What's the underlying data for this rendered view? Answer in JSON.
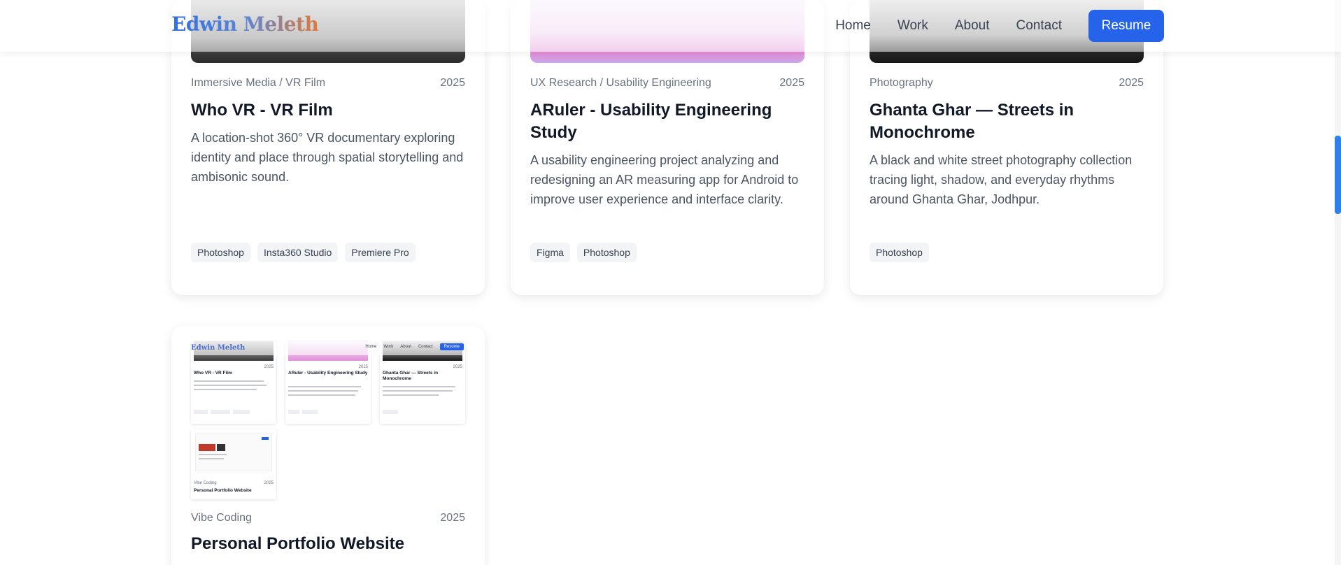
{
  "header": {
    "brand": "Edwin Meleth",
    "nav": [
      "Home",
      "Work",
      "About",
      "Contact"
    ],
    "resume_label": "Resume"
  },
  "projects": [
    {
      "category": "Immersive Media / VR Film",
      "year": "2025",
      "title": "Who VR - VR Film",
      "description": "A location-shot 360° VR documentary exploring identity and place through spatial storytelling and ambisonic sound.",
      "tags": [
        "Photoshop",
        "Insta360 Studio",
        "Premiere Pro"
      ]
    },
    {
      "category": "UX Research / Usability Engineering",
      "year": "2025",
      "title": "ARuler - Usability Engineering Study",
      "description": "A usability engineering project analyzing and redesigning an AR measuring app for Android to improve user experience and interface clarity.",
      "tags": [
        "Figma",
        "Photoshop"
      ]
    },
    {
      "category": "Photography",
      "year": "2025",
      "title": "Ghanta Ghar — Streets in Monochrome",
      "description": "A black and white street photography collection tracing light, shadow, and everyday rhythms around Ghanta Ghar, Jodhpur.",
      "tags": [
        "Photoshop"
      ]
    },
    {
      "category": "Vibe Coding",
      "year": "2025",
      "title": "Personal Portfolio Website"
    }
  ],
  "mini_preview": {
    "brand": "Edwin Meleth",
    "nav": [
      "Home",
      "Work",
      "About",
      "Contact"
    ],
    "resume_label": "Resume",
    "cards": [
      {
        "title": "Who VR - VR Film",
        "year": "2025"
      },
      {
        "title": "ARuler - Usability Engineering Study",
        "year": "2025"
      },
      {
        "title": "Ghanta Ghar — Streets in Monochrome",
        "year": "2025"
      }
    ],
    "bottom_card": {
      "category": "Vibe Coding",
      "year": "2025",
      "title": "Personal Portfolio Website"
    }
  },
  "colors": {
    "accent": "#2563eb",
    "scrollbar_thumb": "#2f80e8"
  }
}
